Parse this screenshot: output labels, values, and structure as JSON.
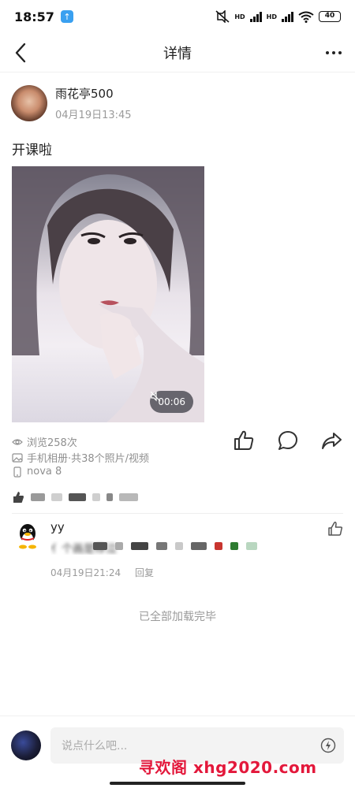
{
  "status_bar": {
    "time": "18:57",
    "app_badge_icon": "upload-arrow-icon",
    "network": [
      "HD",
      "HD"
    ],
    "battery": "40"
  },
  "nav": {
    "title": "详情"
  },
  "post": {
    "author_name": "雨花亭500",
    "timestamp": "04月19日13:45",
    "text": "开课啦",
    "video_duration": "00:06",
    "views": "浏览258次",
    "source": "手机相册·共38个照片/视频",
    "device": "nova 8"
  },
  "comment": {
    "name": "yy",
    "partial_text": "亻个画是荐泣",
    "time": "04月19日21:24",
    "reply_label": "回复"
  },
  "footer_status": "已全部加载完毕",
  "bottom": {
    "input_placeholder": "说点什么吧...",
    "watermark": "寻欢阁 xhg2020.com"
  },
  "colors": {
    "watermark": "#e3183b",
    "secondary_text": "#9a9a9a"
  }
}
